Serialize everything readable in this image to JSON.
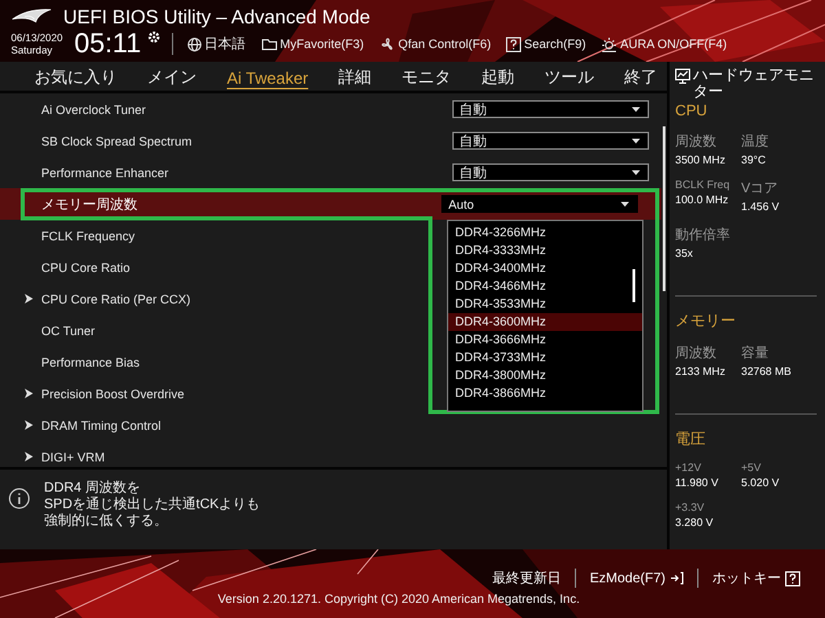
{
  "header": {
    "title": "UEFI BIOS Utility – Advanced Mode",
    "date": "06/13/2020",
    "weekday": "Saturday",
    "time": "05:11",
    "toolbar": [
      {
        "label": "日本語"
      },
      {
        "label": "MyFavorite(F3)"
      },
      {
        "label": "Qfan Control(F6)"
      },
      {
        "label": "Search(F9)"
      },
      {
        "label": "AURA ON/OFF(F4)"
      }
    ]
  },
  "tabs": [
    {
      "label": "お気に入り",
      "selected": false
    },
    {
      "label": "メイン",
      "selected": false
    },
    {
      "label": "Ai Tweaker",
      "selected": true
    },
    {
      "label": "詳細",
      "selected": false
    },
    {
      "label": "モニタ",
      "selected": false
    },
    {
      "label": "起動",
      "selected": false
    },
    {
      "label": "ツール",
      "selected": false
    },
    {
      "label": "終了",
      "selected": false
    }
  ],
  "settings": [
    {
      "label": "Ai Overclock Tuner",
      "submenu": false,
      "value": "自動",
      "selected": false
    },
    {
      "label": "SB Clock Spread Spectrum",
      "submenu": false,
      "value": "自動",
      "selected": false
    },
    {
      "label": "Performance Enhancer",
      "submenu": false,
      "value": "自動",
      "selected": false
    },
    {
      "label": "メモリー周波数",
      "submenu": false,
      "value": "Auto",
      "selected": true
    },
    {
      "label": "FCLK Frequency",
      "submenu": false,
      "selected": false
    },
    {
      "label": "CPU Core Ratio",
      "submenu": false,
      "selected": false
    },
    {
      "label": "CPU Core Ratio (Per CCX)",
      "submenu": true,
      "selected": false
    },
    {
      "label": "OC Tuner",
      "submenu": false,
      "selected": false
    },
    {
      "label": "Performance Bias",
      "submenu": false,
      "selected": false
    },
    {
      "label": "Precision Boost Overdrive",
      "submenu": true,
      "selected": false
    },
    {
      "label": "DRAM Timing Control",
      "submenu": true,
      "selected": false
    },
    {
      "label": "DIGI+ VRM",
      "submenu": true,
      "selected": false
    }
  ],
  "dropdown": {
    "options": [
      {
        "label": "DDR4-3266MHz",
        "selected": false
      },
      {
        "label": "DDR4-3333MHz",
        "selected": false
      },
      {
        "label": "DDR4-3400MHz",
        "selected": false
      },
      {
        "label": "DDR4-3466MHz",
        "selected": false
      },
      {
        "label": "DDR4-3533MHz",
        "selected": false
      },
      {
        "label": "DDR4-3600MHz",
        "selected": true
      },
      {
        "label": "DDR4-3666MHz",
        "selected": false
      },
      {
        "label": "DDR4-3733MHz",
        "selected": false
      },
      {
        "label": "DDR4-3800MHz",
        "selected": false
      },
      {
        "label": "DDR4-3866MHz",
        "selected": false
      }
    ]
  },
  "hardware_monitor": {
    "title": "ハードウェアモニター",
    "sections": [
      {
        "title": "CPU",
        "fields": [
          {
            "label": "周波数",
            "value": "3500 MHz"
          },
          {
            "label": "温度",
            "value": "39°C"
          },
          {
            "label": "BCLK Freq",
            "value": "100.0 MHz"
          },
          {
            "label": "Vコア",
            "value": "1.456 V"
          },
          {
            "label": "動作倍率",
            "value": "35x"
          }
        ]
      },
      {
        "title": "メモリー",
        "fields": [
          {
            "label": "周波数",
            "value": "2133 MHz"
          },
          {
            "label": "容量",
            "value": "32768 MB"
          }
        ]
      },
      {
        "title": "電圧",
        "fields": [
          {
            "label": "+12V",
            "value": "11.980 V"
          },
          {
            "label": "+5V",
            "value": "5.020 V"
          },
          {
            "label": "+3.3V",
            "value": "3.280 V"
          }
        ]
      }
    ]
  },
  "help": {
    "lines": [
      "DDR4 周波数を",
      "SPDを通じ検出した共通tCKよりも",
      "強制的に低くする。"
    ]
  },
  "footer": {
    "buttons": [
      {
        "label": "最終更新日"
      },
      {
        "label": "EzMode(F7)"
      },
      {
        "label": "ホットキー"
      }
    ],
    "version": "Version 2.20.1271. Copyright (C) 2020 American Megatrends, Inc."
  }
}
